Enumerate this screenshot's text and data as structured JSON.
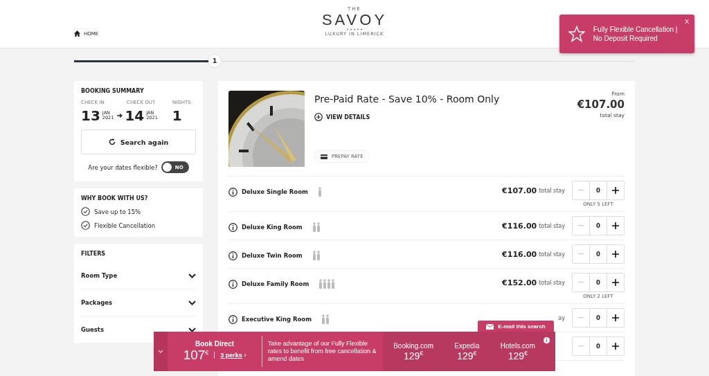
{
  "header": {
    "home": "HOME",
    "logo_top": "THE",
    "logo": "SAVOY",
    "logo_sub": "LUXURY IN LIMERICK"
  },
  "toast": {
    "text": "Fully Flexible Cancellation | No Deposit Required",
    "close": "X"
  },
  "progress": {
    "step": "1",
    "level": 0.24
  },
  "summary": {
    "title": "BOOKING SUMMARY",
    "check_in_label": "CHECK IN",
    "check_out_label": "CHECK OUT",
    "nights_label": "NIGHTS",
    "check_in": {
      "day": "13",
      "month": "JAN",
      "year": "2021"
    },
    "check_out": {
      "day": "14",
      "month": "JAN",
      "year": "2021"
    },
    "nights": "1",
    "search_button": "Search again",
    "flexible": {
      "label": "Are your dates flexible?",
      "on": false,
      "state_label": "NO"
    }
  },
  "why": {
    "title": "WHY BOOK WITH US?",
    "items": [
      "Save up to 15%",
      "Flexible Cancellation"
    ]
  },
  "filters": {
    "title": "FILTERS",
    "items": [
      {
        "label": "Room Type",
        "expanded": false
      },
      {
        "label": "Packages",
        "expanded": false
      },
      {
        "label": "Guests",
        "expanded": false
      }
    ]
  },
  "rate": {
    "title": "Pre-Paid Rate - Save 10% - Room Only",
    "details": "VIEW DETAILS",
    "tag": "PREPAY RATE",
    "from": "From",
    "price": "€107.00",
    "price_note": "total stay"
  },
  "rooms": [
    {
      "name": "Deluxe Single Room",
      "kind": "single",
      "price": "€107.00",
      "note": "total stay",
      "qty": "0",
      "left": "ONLY 5 LEFT"
    },
    {
      "name": "Deluxe King Room",
      "kind": "double",
      "price": "€116.00",
      "note": "total stay",
      "qty": "0"
    },
    {
      "name": "Deluxe Twin Room",
      "kind": "double",
      "price": "€116.00",
      "note": "total stay",
      "qty": "0"
    },
    {
      "name": "Deluxe Family Room",
      "kind": "family",
      "price": "€152.00",
      "note": "total stay",
      "qty": "0",
      "left": "ONLY 2 LEFT"
    },
    {
      "name": "Executive King Room",
      "kind": "double",
      "note": "ay",
      "qty": "0"
    },
    {
      "qty": "0"
    }
  ],
  "banner": {
    "email": "E-mail this search",
    "title": "Book Direct",
    "price": "107",
    "currency": "€",
    "perks": "3 perks",
    "perks_arrow": "›",
    "text": "Take advantage of our Fully Flexible rates to benefit from free cancellation & amend dates",
    "competitors": [
      {
        "name": "Booking.com",
        "price": "129",
        "currency": "€"
      },
      {
        "name": "Expedia",
        "price": "129",
        "currency": "€"
      },
      {
        "name": "Hotels.com",
        "price": "129",
        "currency": "€"
      }
    ]
  }
}
